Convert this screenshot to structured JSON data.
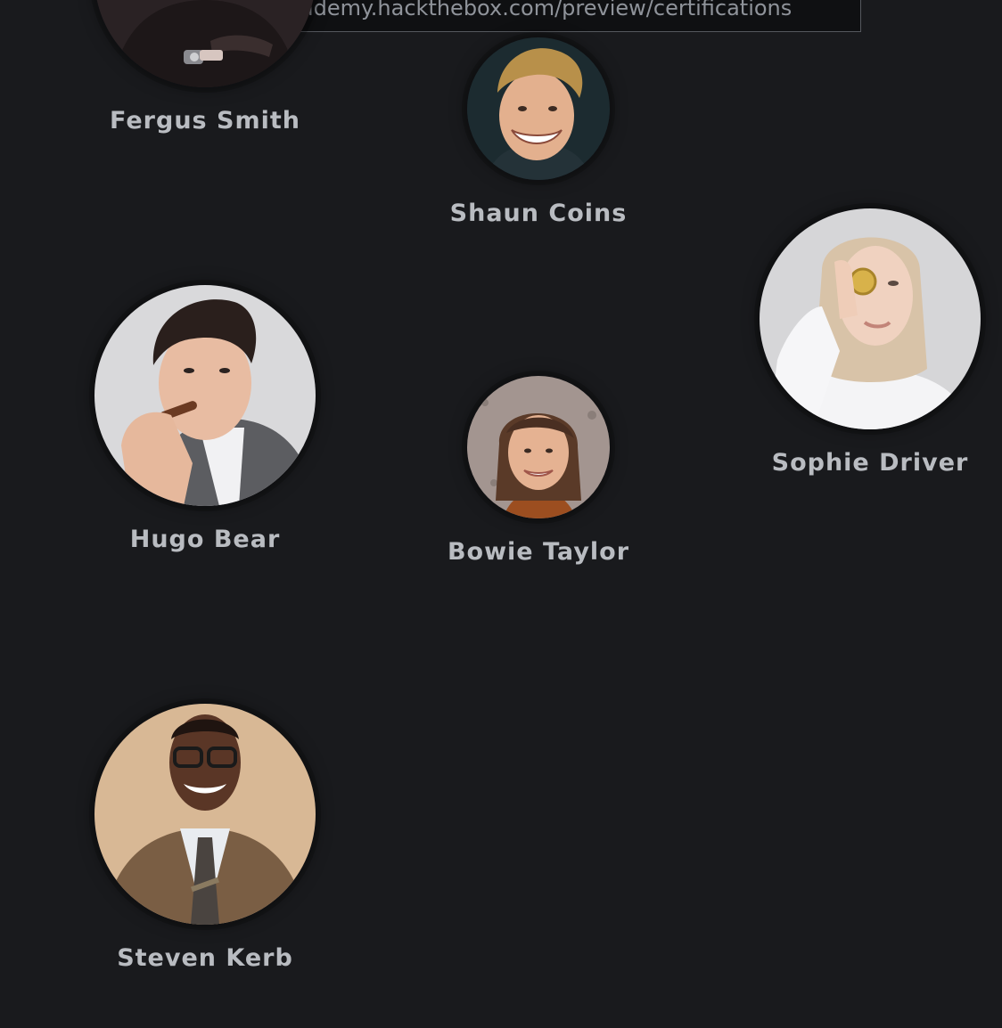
{
  "tooltip": {
    "url": "https://academy.hackthebox.com/preview/certifications"
  },
  "team": [
    {
      "name": "Fergus Smith",
      "avatar_icon": "person-portrait-dark-suit"
    },
    {
      "name": "Shaun Coins",
      "avatar_icon": "person-portrait-smiling-blond-man"
    },
    {
      "name": "Sophie Driver",
      "avatar_icon": "person-portrait-woman-holding-coin"
    },
    {
      "name": "Hugo Bear",
      "avatar_icon": "person-portrait-man-with-cigar"
    },
    {
      "name": "Bowie Taylor",
      "avatar_icon": "person-portrait-smiling-woman"
    },
    {
      "name": "Steven Kerb",
      "avatar_icon": "person-portrait-man-in-tweed-suit"
    }
  ],
  "colors": {
    "background": "#191a1d",
    "name_text": "#b9bcc1",
    "tooltip_border": "#55585e"
  }
}
